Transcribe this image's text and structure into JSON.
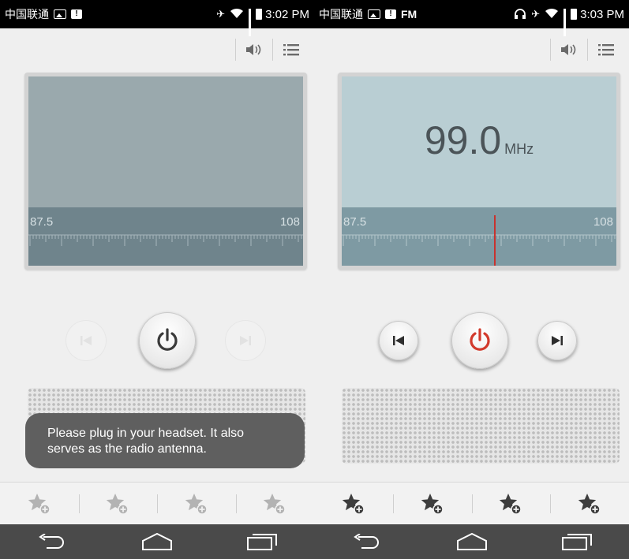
{
  "left": {
    "status": {
      "carrier": "中国联通",
      "time": "3:02 PM"
    },
    "dial": {
      "low": "87.5",
      "high": "108"
    },
    "toast": "Please plug in your headset. It also serves as the radio antenna."
  },
  "right": {
    "status": {
      "carrier": "中国联通",
      "fm": "FM",
      "time": "3:03 PM"
    },
    "frequency": {
      "value": "99.0",
      "unit": "MHz"
    },
    "dial": {
      "low": "87.5",
      "high": "108",
      "tuned_fraction": 0.555
    }
  },
  "icons": {
    "volume": "volume-icon",
    "menu": "menu-list-icon",
    "prev": "previous-station-icon",
    "next": "next-station-icon",
    "power": "power-icon",
    "favorite": "add-favorite-icon",
    "back": "back-icon",
    "home": "home-icon",
    "recents": "recent-apps-icon"
  },
  "colors": {
    "lcd_off_top": "#9aa9ad",
    "lcd_off_bottom": "#6f848c",
    "lcd_on_top": "#b9ced3",
    "lcd_on_bottom": "#7e9aa3",
    "needle": "#c8322e",
    "power_on": "#d23a2c",
    "power_off": "#3a3a3a"
  }
}
